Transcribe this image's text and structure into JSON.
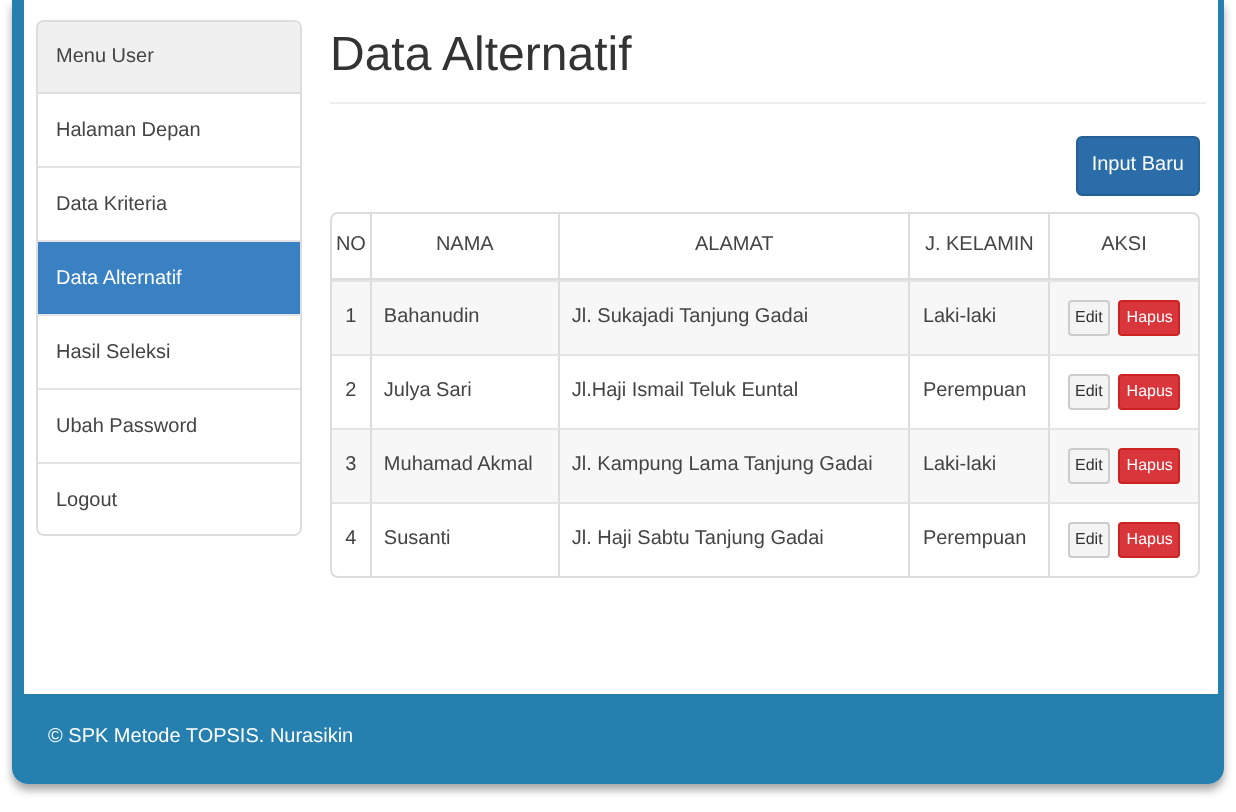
{
  "sidebar": {
    "title": "Menu User",
    "items": [
      {
        "label": "Halaman Depan",
        "selected": false
      },
      {
        "label": "Data Kriteria",
        "selected": false
      },
      {
        "label": "Data Alternatif",
        "selected": true
      },
      {
        "label": "Hasil Seleksi",
        "selected": false
      },
      {
        "label": "Ubah Password",
        "selected": false
      },
      {
        "label": "Logout",
        "selected": false
      }
    ]
  },
  "page_title": "Data Alternatif",
  "add_button": "Input Baru",
  "table": {
    "columns": [
      "NO",
      "NAMA",
      "ALAMAT",
      "J. KELAMIN",
      "AKSI"
    ],
    "rows": [
      {
        "no": "1",
        "nama": "Bahanudin",
        "alamat": "Jl. Sukajadi Tanjung Gadai",
        "kelamin": "Laki-laki",
        "edit": "Edit",
        "hapus": "Hapus"
      },
      {
        "no": "2",
        "nama": "Julya Sari",
        "alamat": "Jl.Haji Ismail Teluk Euntal",
        "kelamin": "Perempuan",
        "edit": "Edit",
        "hapus": "Hapus"
      },
      {
        "no": "3",
        "nama": "Muhamad Akmal",
        "alamat": "Jl. Kampung Lama Tanjung Gadai",
        "kelamin": "Laki-laki",
        "edit": "Edit",
        "hapus": "Hapus"
      },
      {
        "no": "4",
        "nama": "Susanti",
        "alamat": "Jl. Haji Sabtu Tanjung Gadai",
        "kelamin": "Perempuan",
        "edit": "Edit",
        "hapus": "Hapus"
      }
    ]
  },
  "footer": "© SPK Metode TOPSIS. Nurasikin"
}
